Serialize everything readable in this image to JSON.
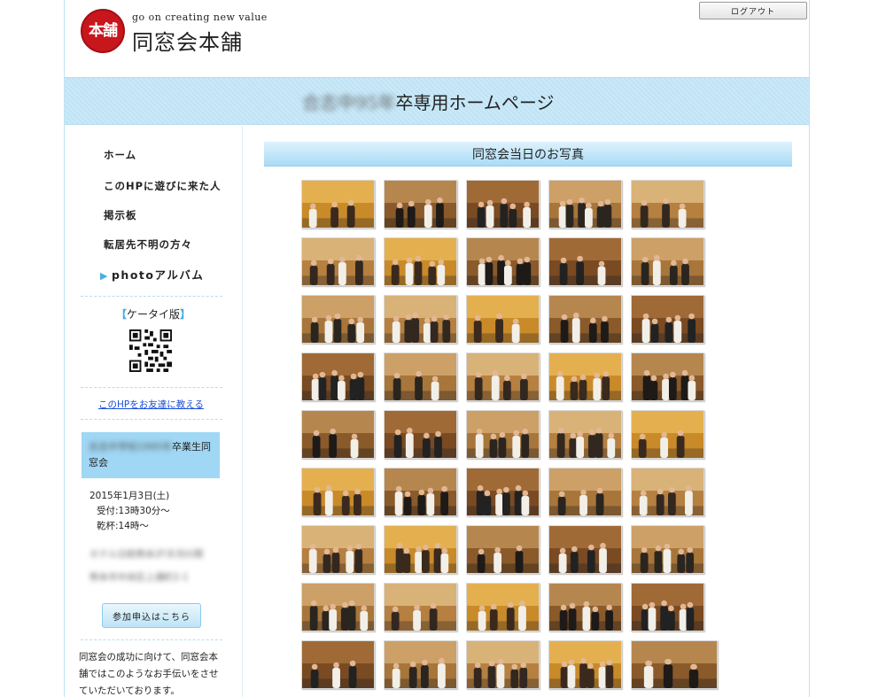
{
  "header": {
    "logo_seal_text": "本舗",
    "tagline": "go on creating new value",
    "brand": "同窓会本舗",
    "logout_label": "ログアウト"
  },
  "banner": {
    "blurred_prefix": "合志中95年",
    "title_suffix": "卒専用ホームページ"
  },
  "sidebar": {
    "nav": [
      {
        "label": "ホーム"
      },
      {
        "label": "このHPに遊びに来た人"
      },
      {
        "label": "掲示板"
      },
      {
        "label": "転居先不明の方々"
      },
      {
        "label": "photoアルバム",
        "active": true
      }
    ],
    "ketai": {
      "open": "【",
      "label": "ケータイ版",
      "close": "】"
    },
    "share_link": "このHPをお友達に教える",
    "event": {
      "blurred_name": "合志中学校1995年",
      "suffix": "卒業生同窓会"
    },
    "date": "2015年1月3日(土)",
    "reception": "受付:13時30分～",
    "toast": "乾杯:14時～",
    "blurred_venue": "ホテル日航熊本2F天河の間",
    "blurred_address": "熊本市中央区上通町2-1",
    "apply_label": "参加申込はこちら",
    "support_text": "同窓会の成功に向けて、同窓会本舗ではこのようなお手伝いをさせていただいております。"
  },
  "main": {
    "title": "同窓会当日のお写真"
  }
}
